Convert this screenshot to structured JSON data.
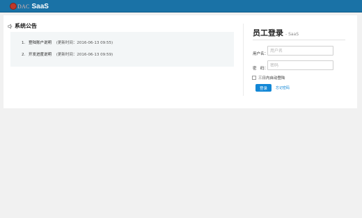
{
  "header": {
    "logo_brand": "DAC",
    "logo_product": "SaaS",
    "bar_color": "#1a72a6"
  },
  "notices": {
    "title": "系统公告",
    "items": [
      {
        "num": "1.",
        "title": "登陆账户说明",
        "time": "(更新时间：2016-06-13 09:55)"
      },
      {
        "num": "2.",
        "title": "开发进度说明",
        "time": "(更新时间：2016-06-13 09:59)"
      }
    ]
  },
  "login": {
    "title": "员工登录",
    "subtitle": "- SaaS",
    "username_label": "用户名：",
    "username_placeholder": "用户名",
    "password_label": "密　码：",
    "password_placeholder": "密码",
    "remember_label": "三日内自动登陆",
    "submit_label": "登录",
    "forgot_label": "忘记密码",
    "accent_color": "#1287d6"
  }
}
